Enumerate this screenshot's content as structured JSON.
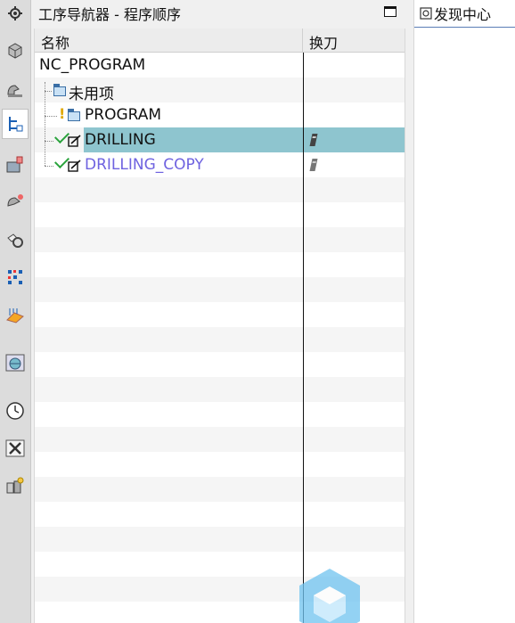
{
  "navigator": {
    "title": "工序导航器 - 程序顺序",
    "columns": {
      "name": "名称",
      "tool_change": "换刀"
    }
  },
  "tree": {
    "root": "NC_PROGRAM",
    "unused": "未用项",
    "program": "PROGRAM",
    "op1": "DRILLING",
    "op2": "DRILLING_COPY"
  },
  "right_panel": {
    "title": "发现中心"
  },
  "left_toolbar": {
    "icons": [
      "settings-gear-icon",
      "part-3d-icon",
      "machine-tool-icon",
      "operation-navigator-icon",
      "tool-navigator-icon",
      "geometry-navigator-icon",
      "method-navigator-icon",
      "assembly-navigator-icon",
      "feature-navigator-icon",
      "web-browser-icon",
      "history-clock-icon",
      "tools-repair-icon",
      "roles-icon"
    ]
  },
  "colors": {
    "selection": "#8ec5cf",
    "copy_op": "#6f63e0",
    "check": "#2aa33c",
    "warning": "#e0a800"
  }
}
